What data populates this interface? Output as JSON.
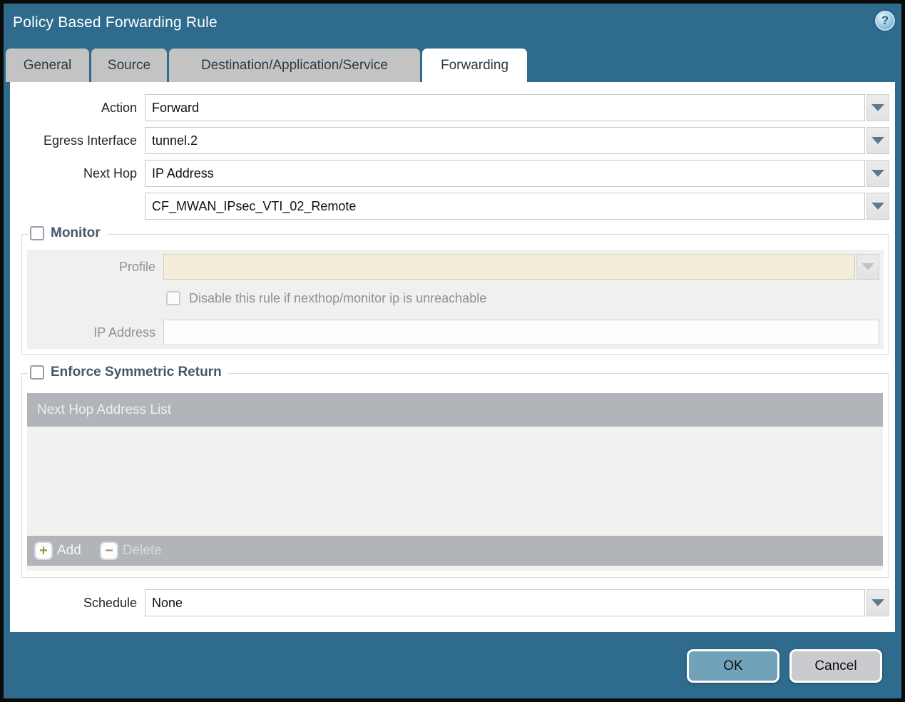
{
  "window": {
    "title": "Policy Based Forwarding Rule"
  },
  "tabs": [
    {
      "label": "General",
      "active": false
    },
    {
      "label": "Source",
      "active": false
    },
    {
      "label": "Destination/Application/Service",
      "active": false
    },
    {
      "label": "Forwarding",
      "active": true
    }
  ],
  "form": {
    "action": {
      "label": "Action",
      "value": "Forward"
    },
    "egress_interface": {
      "label": "Egress Interface",
      "value": "tunnel.2"
    },
    "next_hop": {
      "label": "Next Hop",
      "value": "IP Address"
    },
    "next_hop_address": {
      "value": "CF_MWAN_IPsec_VTI_02_Remote"
    },
    "schedule": {
      "label": "Schedule",
      "value": "None"
    }
  },
  "monitor": {
    "legend": "Monitor",
    "checked": false,
    "profile": {
      "label": "Profile",
      "value": ""
    },
    "disable_rule": {
      "label": "Disable this rule if nexthop/monitor ip is unreachable",
      "checked": false
    },
    "ip_address": {
      "label": "IP Address",
      "value": ""
    }
  },
  "symmetric_return": {
    "legend": "Enforce Symmetric Return",
    "checked": false,
    "table": {
      "header": "Next Hop Address List",
      "rows": []
    },
    "add_label": "Add",
    "delete_label": "Delete",
    "delete_enabled": false
  },
  "footer": {
    "ok_label": "OK",
    "cancel_label": "Cancel"
  },
  "icons": {
    "help": "question-mark",
    "dropdown": "chevron-down-triangle",
    "add": "plus",
    "delete": "minus"
  },
  "colors": {
    "dialog_bg": "#2e6b8c",
    "tab_inactive_bg": "#c3c3c3",
    "tab_active_bg": "#ffffff",
    "legend_text": "#44586b",
    "disabled_field_bg": "#f3edda",
    "panel_bg": "#f0f0ee",
    "table_header_bg": "#b1b5b9",
    "table_body_bg": "#f1f1f0",
    "add_icon_green": "#8ca23f",
    "delete_icon_red": "#b5897b",
    "ok_button_bg": "#72a2ba",
    "cancel_button_bg": "#c9cbce"
  }
}
